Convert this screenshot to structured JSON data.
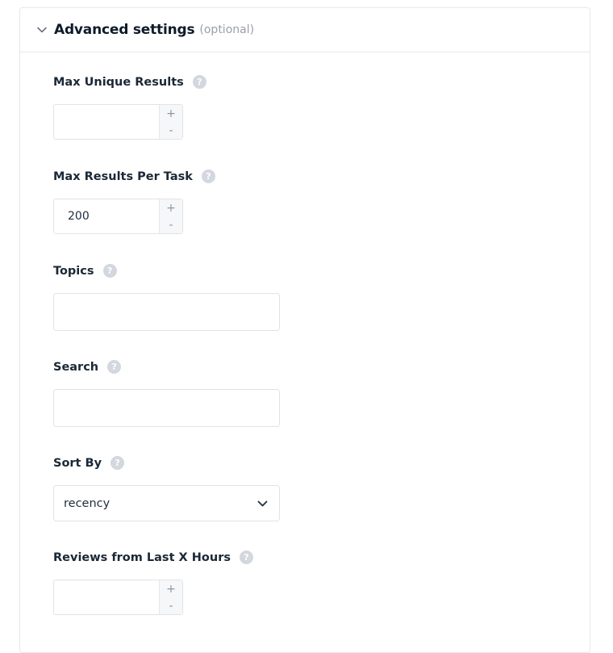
{
  "header": {
    "title": "Advanced settings",
    "optional_label": "(optional)",
    "toggle_icon": "chevron-down-icon"
  },
  "fields": {
    "max_unique_results": {
      "label": "Max Unique Results",
      "value": "",
      "increment": "+",
      "decrement": "-"
    },
    "max_results_per_task": {
      "label": "Max Results Per Task",
      "value": "200",
      "increment": "+",
      "decrement": "-"
    },
    "topics": {
      "label": "Topics",
      "value": ""
    },
    "search": {
      "label": "Search",
      "value": ""
    },
    "sort_by": {
      "label": "Sort By",
      "selected": "recency"
    },
    "reviews_last_x_hours": {
      "label": "Reviews from Last X Hours",
      "value": "",
      "increment": "+",
      "decrement": "-"
    }
  },
  "help_icon_glyph": "?",
  "colors": {
    "help_icon_bg": "#d3d7de",
    "border": "#e0e3e8",
    "title": "#0d1b2a",
    "muted": "#9aa0a8"
  }
}
